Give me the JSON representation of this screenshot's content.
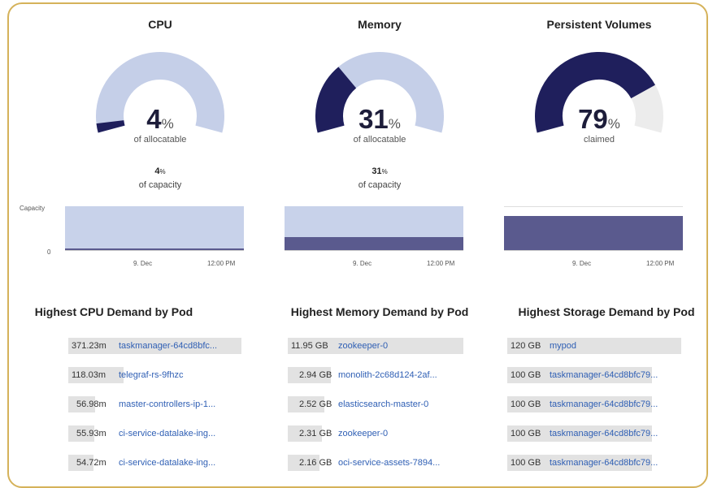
{
  "panels": [
    {
      "title": "CPU",
      "gauge": {
        "value": "4",
        "unit": "%",
        "sub": "of allocatable",
        "fraction": 0.04
      },
      "capacity": {
        "value": "4",
        "unit": "%",
        "sub": "of capacity"
      },
      "chart": {
        "y_label": "Capacity",
        "y_zero": "0",
        "x_ticks": [
          "9. Dec",
          "12:00 PM"
        ]
      },
      "list_title": "Highest CPU Demand by Pod",
      "items": [
        {
          "value": "371.23m",
          "name": "taskmanager-64cd8bfc..."
        },
        {
          "value": "118.03m",
          "name": "telegraf-rs-9fhzc"
        },
        {
          "value": "56.98m",
          "name": "master-controllers-ip-1..."
        },
        {
          "value": "55.93m",
          "name": "ci-service-datalake-ing..."
        },
        {
          "value": "54.72m",
          "name": "ci-service-datalake-ing..."
        }
      ]
    },
    {
      "title": "Memory",
      "gauge": {
        "value": "31",
        "unit": "%",
        "sub": "of allocatable",
        "fraction": 0.31
      },
      "capacity": {
        "value": "31",
        "unit": "%",
        "sub": "of capacity"
      },
      "chart": {
        "x_ticks": [
          "9. Dec",
          "12:00 PM"
        ]
      },
      "list_title": "Highest Memory Demand by Pod",
      "items": [
        {
          "value": "11.95 GB",
          "name": "zookeeper-0"
        },
        {
          "value": "2.94 GB",
          "name": "monolith-2c68d124-2af..."
        },
        {
          "value": "2.52 GB",
          "name": "elasticsearch-master-0"
        },
        {
          "value": "2.31 GB",
          "name": "zookeeper-0"
        },
        {
          "value": "2.16 GB",
          "name": "oci-service-assets-7894..."
        }
      ]
    },
    {
      "title": "Persistent Volumes",
      "gauge": {
        "value": "79",
        "unit": "%",
        "sub": "claimed",
        "fraction": 0.79
      },
      "chart": {
        "x_ticks": [
          "9. Dec",
          "12:00 PM"
        ]
      },
      "list_title": "Highest Storage Demand by Pod",
      "items": [
        {
          "value": "120 GB",
          "name": "mypod"
        },
        {
          "value": "100 GB",
          "name": "taskmanager-64cd8bfc79..."
        },
        {
          "value": "100 GB",
          "name": "taskmanager-64cd8bfc79..."
        },
        {
          "value": "100 GB",
          "name": "taskmanager-64cd8bfc79..."
        },
        {
          "value": "100 GB",
          "name": "taskmanager-64cd8bfc79..."
        }
      ]
    }
  ],
  "colors": {
    "gauge_fill": "#1f1f5c",
    "gauge_track_blue": "#c5cfe8",
    "gauge_track_grey": "#ececec",
    "chart_fill": "#5a5a8e",
    "chart_bg": "#c8d2ea",
    "link": "#2f5fb4",
    "frame": "#d5b25a"
  }
}
